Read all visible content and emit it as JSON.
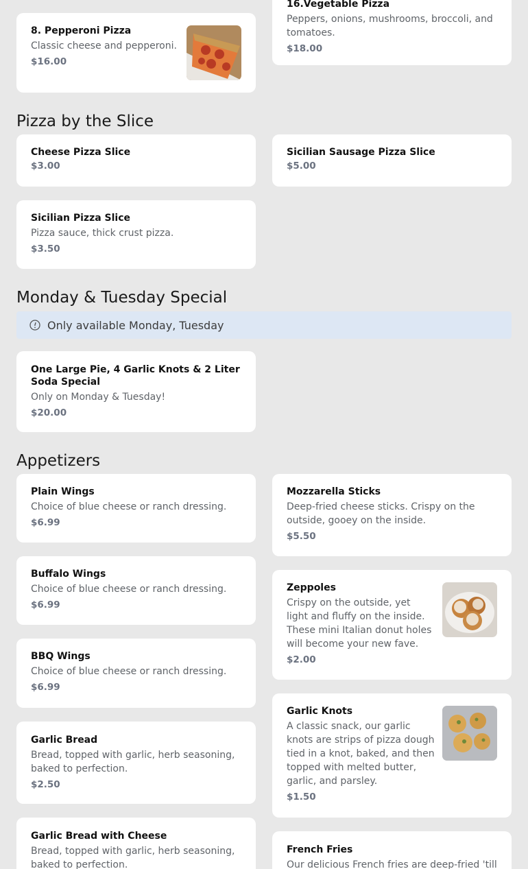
{
  "sections": {
    "pizza_by_slice": "Pizza by the Slice",
    "special": "Monday & Tuesday Special",
    "appetizers": "Appetizers"
  },
  "notice": {
    "text": "Only available Monday, Tuesday",
    "icon": "info-icon"
  },
  "items": {
    "pepperoni": {
      "name": "8. Pepperoni Pizza",
      "desc": "Classic cheese and pepperoni.",
      "price": "$16.00"
    },
    "vegetable": {
      "name": "16.Vegetable Pizza",
      "desc": "Peppers, onions, mushrooms, broccoli, and tomatoes.",
      "price": "$18.00"
    },
    "cheese_slice": {
      "name": "Cheese Pizza Slice",
      "price": "$3.00"
    },
    "sicilian_sausage_slice": {
      "name": "Sicilian Sausage Pizza Slice",
      "price": "$5.00"
    },
    "sicilian_slice": {
      "name": "Sicilian Pizza Slice",
      "desc": "Pizza sauce, thick crust pizza.",
      "price": "$3.50"
    },
    "special_combo": {
      "name": "One Large Pie, 4 Garlic Knots & 2 Liter Soda Special",
      "desc": "Only on Monday & Tuesday!",
      "price": "$20.00"
    },
    "plain_wings": {
      "name": "Plain Wings",
      "desc": "Choice of blue cheese or ranch dressing.",
      "price": "$6.99"
    },
    "mozzarella_sticks": {
      "name": "Mozzarella Sticks",
      "desc": "Deep-fried cheese sticks. Crispy on the outside, gooey on the inside.",
      "price": "$5.50"
    },
    "buffalo_wings": {
      "name": "Buffalo Wings",
      "desc": "Choice of blue cheese or ranch dressing.",
      "price": "$6.99"
    },
    "zeppoles": {
      "name": "Zeppoles",
      "desc": "Crispy on the outside, yet light and fluffy on the inside. These mini Italian donut holes will become your new fave.",
      "price": "$2.00"
    },
    "bbq_wings": {
      "name": "BBQ Wings",
      "desc": "Choice of blue cheese or ranch dressing.",
      "price": "$6.99"
    },
    "garlic_knots": {
      "name": "Garlic Knots",
      "desc": "A classic snack, our garlic knots are strips of pizza dough tied in a knot, baked, and then topped with melted butter, garlic, and parsley.",
      "price": "$1.50"
    },
    "garlic_bread": {
      "name": "Garlic Bread",
      "desc": "Bread, topped with garlic, herb seasoning, baked to perfection.",
      "price": "$2.50"
    },
    "garlic_bread_cheese": {
      "name": "Garlic Bread with Cheese",
      "desc": "Bread, topped with garlic, herb seasoning, baked to perfection."
    },
    "french_fries": {
      "name": "French Fries",
      "desc": "Our delicious French fries are deep-fried 'till"
    }
  },
  "colors": {
    "background": "#e8e8e8",
    "card": "#ffffff",
    "notice_bg": "#dde7f4",
    "price": "#6b7280"
  }
}
